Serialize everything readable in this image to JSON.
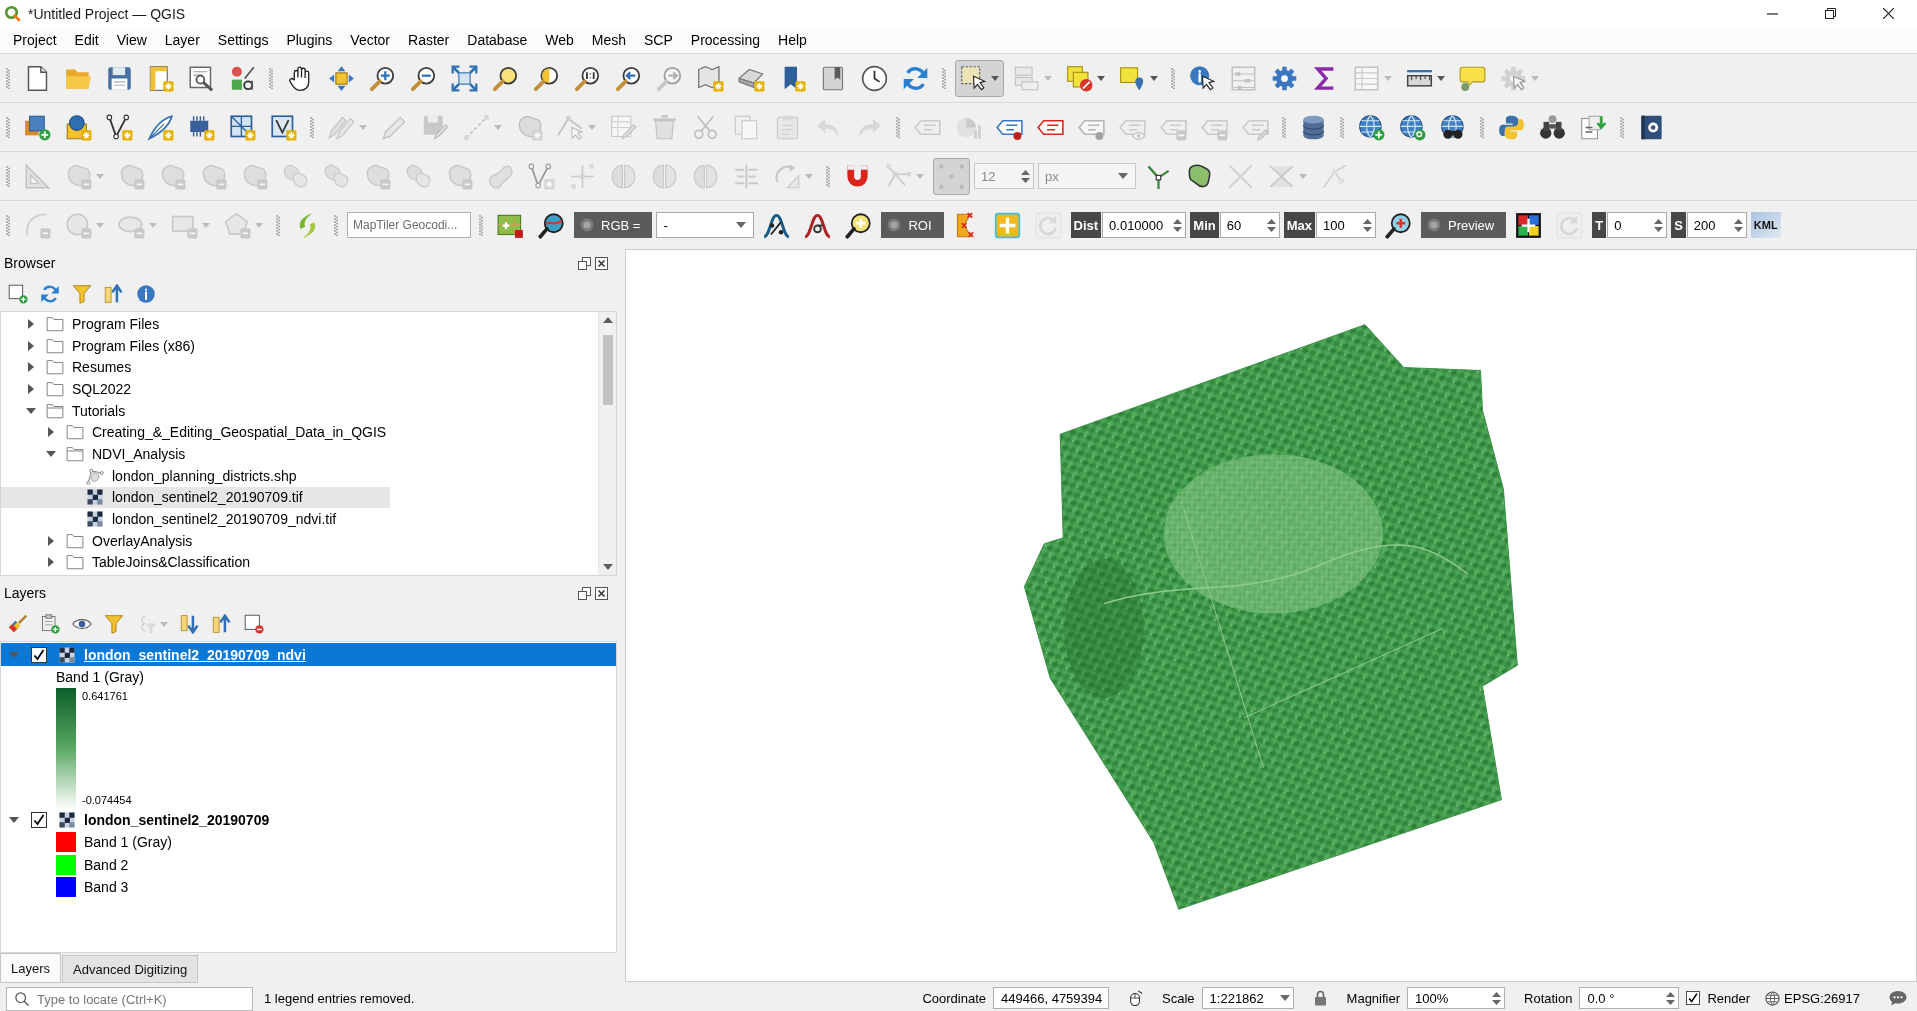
{
  "window": {
    "title": "*Untitled Project — QGIS"
  },
  "menu": [
    "Project",
    "Edit",
    "View",
    "Layer",
    "Settings",
    "Plugins",
    "Vector",
    "Raster",
    "Database",
    "Web",
    "Mesh",
    "SCP",
    "Processing",
    "Help"
  ],
  "toolbars": [
    {
      "groups": [
        {
          "items": [
            {
              "kind": "page",
              "disabled": false,
              "checked": false
            },
            {
              "kind": "open",
              "disabled": false,
              "checked": false
            },
            {
              "kind": "floppy",
              "disabled": false,
              "checked": false
            },
            {
              "kind": "layout",
              "disabled": false,
              "checked": false
            },
            {
              "kind": "layouts",
              "disabled": false,
              "checked": false
            },
            {
              "kind": "styles",
              "disabled": false,
              "checked": false
            }
          ]
        },
        {
          "items": [
            {
              "kind": "hand",
              "disabled": false,
              "checked": false
            },
            {
              "kind": "movearrows",
              "disabled": false,
              "checked": false
            },
            {
              "kind": "zoomin",
              "disabled": false,
              "checked": false
            },
            {
              "kind": "zoomout",
              "disabled": false,
              "checked": false
            },
            {
              "kind": "zoomfull",
              "disabled": false,
              "checked": false
            },
            {
              "kind": "zoomlayer",
              "disabled": false,
              "checked": false
            },
            {
              "kind": "zoomsel",
              "disabled": false,
              "checked": false
            },
            {
              "kind": "zoomnative",
              "disabled": false,
              "checked": false
            },
            {
              "kind": "zoomlast",
              "disabled": false,
              "checked": false
            },
            {
              "kind": "zoomnext",
              "disabled": true,
              "checked": false
            },
            {
              "kind": "newmap",
              "disabled": false,
              "checked": false
            },
            {
              "kind": "map3d",
              "disabled": false,
              "checked": false
            },
            {
              "kind": "bookmark",
              "disabled": false,
              "checked": false
            },
            {
              "kind": "bookmarks",
              "disabled": false,
              "checked": false
            },
            {
              "kind": "clock",
              "disabled": false,
              "checked": false
            },
            {
              "kind": "refresh",
              "disabled": false,
              "checked": false
            }
          ]
        },
        {
          "items": [
            {
              "kind": "select",
              "disabled": false,
              "checked": true,
              "menu": true
            },
            {
              "kind": "stacked",
              "disabled": true,
              "checked": false,
              "menu": true
            },
            {
              "kind": "deselect",
              "disabled": false,
              "checked": false,
              "menu": true
            },
            {
              "kind": "selectloc",
              "disabled": false,
              "checked": false,
              "menu": true
            }
          ]
        },
        {
          "items": [
            {
              "kind": "identify",
              "disabled": false,
              "checked": false
            },
            {
              "kind": "abacus",
              "disabled": true,
              "checked": false
            },
            {
              "kind": "gear",
              "disabled": false,
              "checked": false
            },
            {
              "kind": "sigma",
              "disabled": false,
              "checked": false
            },
            {
              "kind": "table",
              "disabled": true,
              "checked": false,
              "menu": true
            },
            {
              "kind": "ruler",
              "disabled": false,
              "checked": false,
              "menu": true
            },
            {
              "kind": "tip",
              "disabled": false,
              "checked": false
            },
            {
              "kind": "actiongear",
              "disabled": true,
              "checked": false,
              "menu": true
            }
          ]
        }
      ]
    },
    {
      "groups": [
        {
          "items": [
            {
              "kind": "addlayers",
              "disabled": false,
              "checked": false
            },
            {
              "kind": "globebox",
              "disabled": false,
              "checked": false
            },
            {
              "kind": "vnodes",
              "disabled": false,
              "checked": false
            },
            {
              "kind": "feather",
              "disabled": false,
              "checked": false
            },
            {
              "kind": "chip",
              "disabled": false,
              "checked": false
            },
            {
              "kind": "grid",
              "disabled": false,
              "checked": false
            },
            {
              "kind": "vbox",
              "disabled": false,
              "checked": false
            }
          ]
        },
        {
          "items": [
            {
              "kind": "pencils",
              "disabled": true,
              "checked": false,
              "menu": true
            },
            {
              "kind": "pencil",
              "disabled": true,
              "checked": false
            },
            {
              "kind": "floppyedit",
              "disabled": true,
              "checked": false
            },
            {
              "kind": "dline",
              "disabled": true,
              "checked": false,
              "menu": true
            },
            {
              "kind": "blob",
              "disabled": true,
              "checked": false
            },
            {
              "kind": "vertextool",
              "disabled": true,
              "checked": false,
              "menu": true
            },
            {
              "kind": "tableedit",
              "disabled": true,
              "checked": false
            },
            {
              "kind": "trash",
              "disabled": true,
              "checked": false
            },
            {
              "kind": "scissors",
              "disabled": true,
              "checked": false
            },
            {
              "kind": "copy",
              "disabled": true,
              "checked": false
            },
            {
              "kind": "paste",
              "disabled": true,
              "checked": false
            },
            {
              "kind": "undo",
              "disabled": true,
              "checked": false
            },
            {
              "kind": "redo",
              "disabled": true,
              "checked": false
            }
          ]
        },
        {
          "items": [
            {
              "kind": "label",
              "disabled": true,
              "checked": false
            },
            {
              "kind": "pie",
              "disabled": true,
              "checked": false
            },
            {
              "kind": "labelpin",
              "disabled": false,
              "checked": false
            },
            {
              "kind": "labelred",
              "disabled": false,
              "checked": false
            },
            {
              "kind": "labelpin",
              "disabled": true,
              "checked": false
            },
            {
              "kind": "labeleye",
              "disabled": true,
              "checked": false
            },
            {
              "kind": "labelmove",
              "disabled": true,
              "checked": false
            },
            {
              "kind": "labelrotate",
              "disabled": true,
              "checked": false
            },
            {
              "kind": "labeledit",
              "disabled": true,
              "checked": false
            }
          ]
        },
        {
          "items": [
            {
              "kind": "database",
              "disabled": false,
              "checked": false
            }
          ]
        },
        {
          "items": [
            {
              "kind": "globeplus",
              "disabled": false,
              "checked": false
            },
            {
              "kind": "globesearch",
              "disabled": false,
              "checked": false
            },
            {
              "kind": "globebinoc",
              "disabled": false,
              "checked": false
            }
          ]
        },
        {
          "items": [
            {
              "kind": "python",
              "disabled": false,
              "checked": false
            },
            {
              "kind": "binoculars",
              "disabled": false,
              "checked": false
            },
            {
              "kind": "translate",
              "disabled": false,
              "checked": false
            }
          ]
        },
        {
          "items": [
            {
              "kind": "helpbook",
              "disabled": false,
              "checked": false
            }
          ]
        }
      ]
    },
    {
      "groups": [
        {
          "items": [
            {
              "kind": "setsquare",
              "disabled": true,
              "checked": false
            },
            {
              "kind": "shape",
              "disabled": true,
              "checked": false,
              "menu": true
            },
            {
              "kind": "shape",
              "disabled": true,
              "checked": false
            },
            {
              "kind": "shape",
              "disabled": true,
              "checked": false
            },
            {
              "kind": "shape",
              "disabled": true,
              "checked": false
            },
            {
              "kind": "shape",
              "disabled": true,
              "checked": false
            },
            {
              "kind": "shapes",
              "disabled": true,
              "checked": false
            },
            {
              "kind": "shapes",
              "disabled": true,
              "checked": false
            },
            {
              "kind": "shape",
              "disabled": true,
              "checked": false
            },
            {
              "kind": "shapes",
              "disabled": true,
              "checked": false
            },
            {
              "kind": "shape",
              "disabled": true,
              "checked": false
            },
            {
              "kind": "bean",
              "disabled": true,
              "checked": false
            },
            {
              "kind": "vnodes",
              "disabled": true,
              "checked": false
            },
            {
              "kind": "crossnodes",
              "disabled": true,
              "checked": false
            },
            {
              "kind": "split",
              "disabled": true,
              "checked": false
            },
            {
              "kind": "split",
              "disabled": true,
              "checked": false
            },
            {
              "kind": "split",
              "disabled": true,
              "checked": false
            },
            {
              "kind": "align",
              "disabled": true,
              "checked": false
            },
            {
              "kind": "rotate",
              "disabled": true,
              "checked": false,
              "menu": true
            }
          ]
        },
        {
          "items": [
            {
              "kind": "magnet",
              "disabled": false,
              "checked": false
            },
            {
              "kind": "tracing",
              "disabled": true,
              "checked": false,
              "menu": true
            },
            {
              "kind": "snapgrid",
              "disabled": true,
              "checked": true
            },
            {
              "kind": "spin",
              "value": "12",
              "disabled": true
            },
            {
              "kind": "combo",
              "value": "px",
              "disabled": true
            },
            {
              "kind": "splitgreen",
              "disabled": false,
              "checked": false
            },
            {
              "kind": "reshape",
              "disabled": false,
              "checked": false
            },
            {
              "kind": "cross",
              "disabled": true,
              "checked": false
            },
            {
              "kind": "merge",
              "disabled": true,
              "checked": false,
              "menu": true
            },
            {
              "kind": "nodeline",
              "disabled": true,
              "checked": false
            }
          ]
        }
      ]
    },
    {
      "groups": [
        {
          "items": [
            {
              "kind": "arc",
              "disabled": true,
              "checked": false
            },
            {
              "kind": "circle",
              "disabled": true,
              "checked": false,
              "menu": true
            },
            {
              "kind": "ellipse",
              "disabled": true,
              "checked": false,
              "menu": true
            },
            {
              "kind": "rectangle",
              "disabled": true,
              "checked": false,
              "menu": true
            },
            {
              "kind": "pentagon",
              "disabled": true,
              "checked": false,
              "menu": true
            }
          ]
        },
        {
          "items": [
            {
              "kind": "leaf",
              "disabled": false,
              "checked": false
            }
          ]
        },
        {
          "items": [
            {
              "kind": "field",
              "placeholder": "MapTiler Geocodi..."
            }
          ]
        },
        {
          "items": [
            {
              "kind": "scptool",
              "disabled": false,
              "checked": false
            },
            {
              "kind": "scpzoom",
              "disabled": false,
              "checked": false
            },
            {
              "kind": "toggle",
              "label": "RGB =",
              "checked": false
            },
            {
              "kind": "combo",
              "value": "-",
              "disabled": false
            },
            {
              "kind": "bellpercent",
              "disabled": false,
              "checked": false
            },
            {
              "kind": "bellsigma",
              "disabled": false,
              "checked": false
            },
            {
              "kind": "zoomplus",
              "disabled": false,
              "checked": false
            },
            {
              "kind": "toggle",
              "label": "ROI",
              "checked": false
            },
            {
              "kind": "vertexpoly",
              "disabled": false,
              "checked": false
            },
            {
              "kind": "plus",
              "disabled": false,
              "checked": false
            },
            {
              "kind": "redogrey",
              "disabled": true,
              "checked": false
            },
            {
              "kind": "tag",
              "label": "Dist"
            },
            {
              "kind": "spin",
              "value": "0.010000",
              "disabled": false
            },
            {
              "kind": "tag",
              "label": "Min"
            },
            {
              "kind": "spin",
              "value": "60",
              "disabled": false
            },
            {
              "kind": "tag",
              "label": "Max"
            },
            {
              "kind": "spin",
              "value": "100",
              "disabled": false
            },
            {
              "kind": "zoomcolor",
              "disabled": false,
              "checked": false
            },
            {
              "kind": "toggle",
              "label": "Preview",
              "checked": false
            },
            {
              "kind": "colorgrid",
              "disabled": false,
              "checked": false
            },
            {
              "kind": "redogrey",
              "disabled": true,
              "checked": false
            },
            {
              "kind": "tag",
              "label": "T"
            },
            {
              "kind": "spin",
              "value": "0",
              "disabled": false
            },
            {
              "kind": "tag",
              "label": "S"
            },
            {
              "kind": "spin",
              "value": "200",
              "disabled": false
            },
            {
              "kind": "kml",
              "label": "KML"
            }
          ]
        }
      ]
    }
  ],
  "browser": {
    "title": "Browser",
    "tools": [
      {
        "kind": "newsq",
        "disabled": false,
        "checked": false
      },
      {
        "kind": "refresh",
        "disabled": false,
        "checked": false
      },
      {
        "kind": "funnel",
        "disabled": false,
        "checked": false
      },
      {
        "kind": "collapse",
        "disabled": false,
        "checked": false
      },
      {
        "kind": "info",
        "disabled": false,
        "checked": false
      }
    ],
    "tree": [
      {
        "label": "Program Files",
        "kind": "folder",
        "expanded": false,
        "selected": false
      },
      {
        "label": "Program Files (x86)",
        "kind": "folder",
        "expanded": false,
        "selected": false
      },
      {
        "label": "Resumes",
        "kind": "folder",
        "expanded": false,
        "selected": false
      },
      {
        "label": "SQL2022",
        "kind": "folder",
        "expanded": false,
        "selected": false
      },
      {
        "label": "Tutorials",
        "kind": "folder",
        "expanded": true,
        "selected": false,
        "children": [
          {
            "label": "Creating_&_Editing_Geospatial_Data_in_QGIS",
            "kind": "folder",
            "expanded": false,
            "selected": false
          },
          {
            "label": "NDVI_Analysis",
            "kind": "folder",
            "expanded": true,
            "selected": false,
            "children": [
              {
                "label": "london_planning_districts.shp",
                "kind": "vector",
                "selected": false
              },
              {
                "label": "london_sentinel2_20190709.tif",
                "kind": "raster",
                "selected": true
              },
              {
                "label": "london_sentinel2_20190709_ndvi.tif",
                "kind": "raster",
                "selected": false
              }
            ]
          },
          {
            "label": "OverlayAnalysis",
            "kind": "folder",
            "expanded": false,
            "selected": false
          },
          {
            "label": "TableJoins&Classification",
            "kind": "folder",
            "expanded": false,
            "selected": false
          }
        ]
      }
    ]
  },
  "layers": {
    "title": "Layers",
    "tools": [
      {
        "kind": "brush",
        "disabled": false,
        "checked": false
      },
      {
        "kind": "addgroup",
        "disabled": false,
        "checked": false
      },
      {
        "kind": "eye",
        "disabled": false,
        "checked": false
      },
      {
        "kind": "funnel",
        "disabled": false,
        "checked": false
      },
      {
        "kind": "epsilon",
        "disabled": true,
        "checked": false,
        "menu": true
      },
      {
        "kind": "expand",
        "disabled": false,
        "checked": false
      },
      {
        "kind": "collapse",
        "disabled": false,
        "checked": false
      },
      {
        "kind": "removelayer",
        "disabled": false,
        "checked": false
      }
    ],
    "tree": [
      {
        "label": "london_sentinel2_20190709_ndvi",
        "checked": true,
        "expanded": true,
        "selected": true,
        "legend": {
          "kind": "ramp",
          "title": "Band 1 (Gray)",
          "max": "0.641761",
          "min": "-0.074454"
        }
      },
      {
        "label": "london_sentinel2_20190709",
        "checked": true,
        "expanded": true,
        "selected": false,
        "legend": {
          "kind": "bands",
          "items": [
            {
              "label": "Band 1 (Gray)",
              "color": "#ff0000"
            },
            {
              "label": "Band 2",
              "color": "#00ff00"
            },
            {
              "label": "Band 3",
              "color": "#0000ff"
            }
          ]
        }
      }
    ]
  },
  "dock_tabs": [
    {
      "label": "Layers",
      "selected": true
    },
    {
      "label": "Advanced Digitizing",
      "selected": false
    }
  ],
  "status_bar": {
    "locator": {
      "placeholder": "Type to locate (Ctrl+K)"
    },
    "message": "1 legend entries removed.",
    "coordinate": {
      "label": "Coordinate",
      "value": "449466, 4759394"
    },
    "scale": {
      "label": "Scale",
      "value": "1:221862"
    },
    "magnifier": {
      "label": "Magnifier",
      "value": "100%"
    },
    "rotation": {
      "label": "Rotation",
      "value": "0.0 °"
    },
    "render": {
      "label": "Render",
      "checked": true
    },
    "crs": "EPSG:26917"
  }
}
